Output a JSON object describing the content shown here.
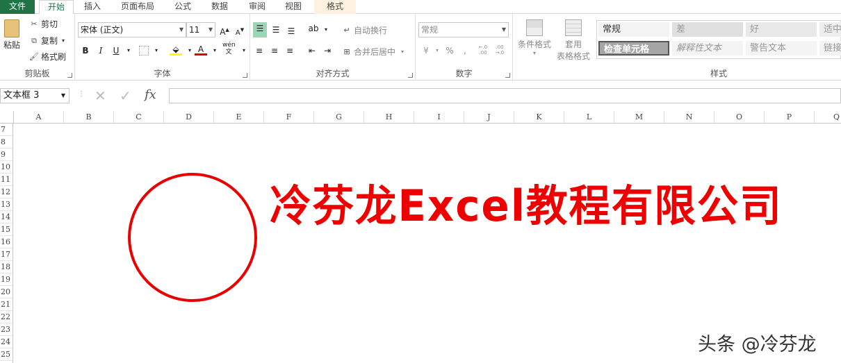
{
  "tabs": [
    "文件",
    "开始",
    "插入",
    "页面布局",
    "公式",
    "数据",
    "审阅",
    "视图",
    "格式"
  ],
  "clipboard": {
    "paste": "粘贴",
    "cut": "剪切",
    "copy": "复制",
    "format_painter": "格式刷",
    "label": "剪贴板"
  },
  "font": {
    "name": "宋体 (正文)",
    "size": "11",
    "bold": "B",
    "italic": "I",
    "underline": "U",
    "increase": "A",
    "decrease": "A",
    "color_letter": "A",
    "phonetic": "wén",
    "label": "字体"
  },
  "alignment": {
    "wrap": "自动换行",
    "merge": "合并后居中",
    "label": "对齐方式"
  },
  "number": {
    "format": "常规",
    "percent": "%",
    "comma": ",",
    "inc_dec": "←.0 .00",
    "dec_dec": ".00 →.0",
    "label": "数字"
  },
  "styles_group": {
    "cond_format": "条件格式",
    "table_format_1": "套用",
    "table_format_2": "表格格式",
    "label": "样式",
    "cells": [
      {
        "text": "常规"
      },
      {
        "text": "差"
      },
      {
        "text": "好"
      },
      {
        "text": "适中"
      },
      {
        "text": "检查单元格"
      },
      {
        "text": "解释性文本"
      },
      {
        "text": "警告文本"
      },
      {
        "text": "链接"
      }
    ]
  },
  "formula_bar": {
    "name_box": "文本框 3",
    "fx": "fx",
    "value": ""
  },
  "columns": [
    "A",
    "B",
    "C",
    "D",
    "E",
    "F",
    "G",
    "H",
    "I",
    "J",
    "K",
    "L",
    "M",
    "N",
    "O",
    "P",
    "Q"
  ],
  "rows": [
    "7",
    "8",
    "9",
    "10",
    "11",
    "12",
    "13",
    "14",
    "15",
    "16",
    "17",
    "18",
    "19",
    "20",
    "21",
    "22",
    "23",
    "24",
    "25"
  ],
  "content": {
    "company": "冷芬龙Excel教程有限公司",
    "watermark": "头条 @冷芬龙"
  },
  "colors": {
    "accent": "#217346",
    "seal_red": "#ee0000"
  }
}
